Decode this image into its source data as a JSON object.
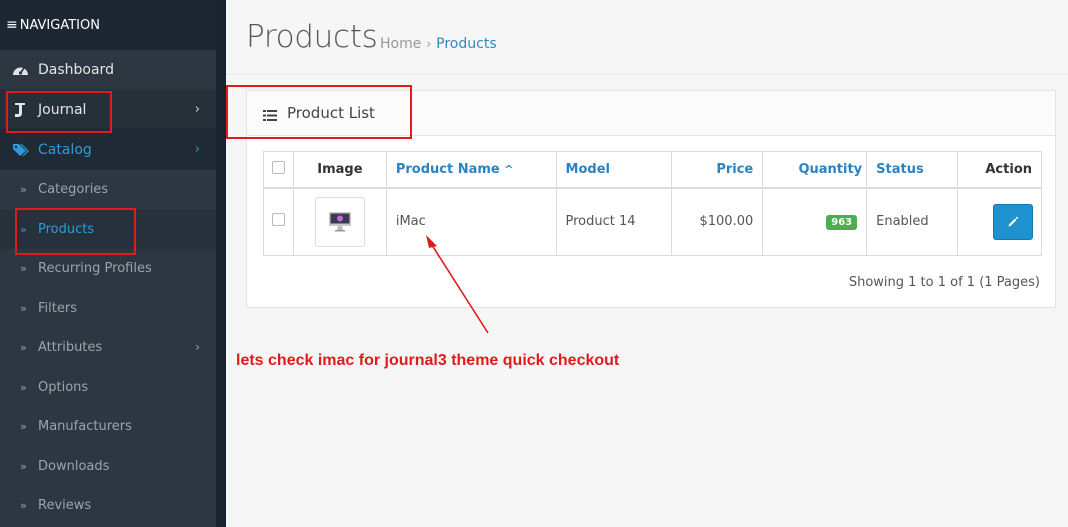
{
  "sidebar": {
    "header": "NAVIGATION",
    "items": [
      {
        "label": "Dashboard",
        "icon": "dashboard-icon"
      },
      {
        "label": "Journal",
        "icon": "journal-icon"
      },
      {
        "label": "Catalog",
        "icon": "tag-icon"
      }
    ],
    "sub_items": [
      {
        "label": "Categories"
      },
      {
        "label": "Products"
      },
      {
        "label": "Recurring Profiles"
      },
      {
        "label": "Filters"
      },
      {
        "label": "Attributes"
      },
      {
        "label": "Options"
      },
      {
        "label": "Manufacturers"
      },
      {
        "label": "Downloads"
      },
      {
        "label": "Reviews"
      }
    ]
  },
  "header": {
    "title": "Products",
    "breadcrumb": [
      "Home",
      "Products"
    ]
  },
  "panel": {
    "title": "Product List",
    "columns": [
      "Image",
      "Product Name",
      "Model",
      "Price",
      "Quantity",
      "Status",
      "Action"
    ],
    "sort_indicator": "^",
    "rows": [
      {
        "name": "iMac",
        "model": "Product 14",
        "price": "$100.00",
        "quantity": "963",
        "status": "Enabled"
      }
    ],
    "pagination": "Showing 1 to 1 of 1 (1 Pages)"
  },
  "annotation": "lets check imac for journal3 theme quick checkout",
  "colors": {
    "accent": "#2f9bdb",
    "annotation": "#e01b1b",
    "badge": "#4cae4c",
    "button": "#1e91cf"
  }
}
